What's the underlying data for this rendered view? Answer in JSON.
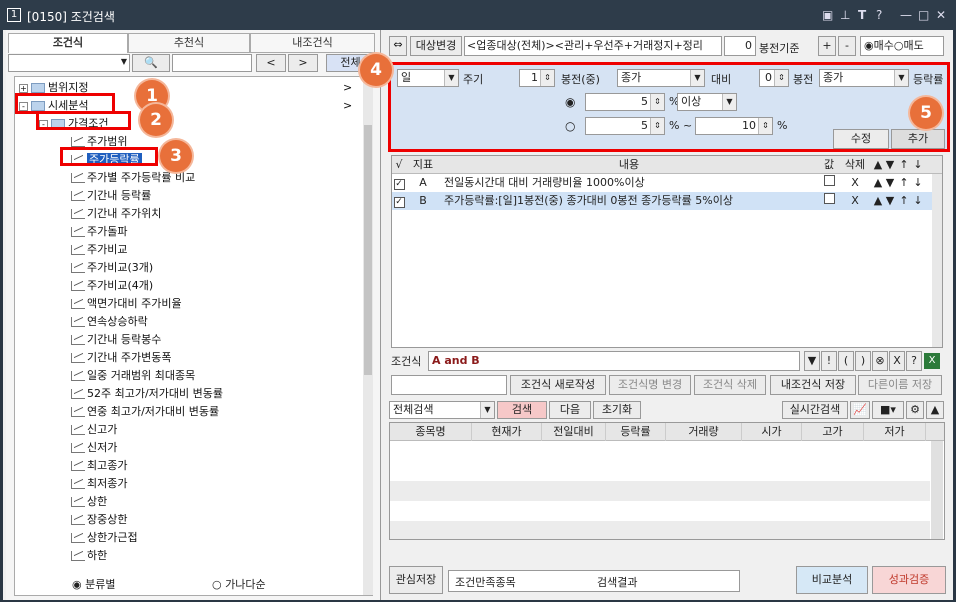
{
  "titlebar": {
    "num": "1",
    "title": "[0150] 조건검색",
    "icons": [
      "window-icon",
      "pin-icon",
      "T",
      "?",
      "minimize-icon",
      "maximize-icon",
      "close-icon"
    ]
  },
  "left": {
    "tabs": [
      "조건식",
      "추천식",
      "내조건식"
    ],
    "nav": {
      "prev": "<",
      "next": ">",
      "all": "전체"
    },
    "tree": [
      {
        "label": "범위지정",
        "level": 0,
        "type": "folder",
        "toggle": "+",
        "arrow": ">"
      },
      {
        "label": "시세분석",
        "level": 0,
        "type": "folder",
        "toggle": "-",
        "arrow": ">"
      },
      {
        "label": "가격조건",
        "level": 1,
        "type": "folder",
        "toggle": "-"
      },
      {
        "label": "주가범위",
        "level": 2,
        "type": "item"
      },
      {
        "label": "주가등락률",
        "level": 2,
        "type": "item",
        "selected": true
      },
      {
        "label": "주가별 주가등락률 비교",
        "level": 2,
        "type": "item"
      },
      {
        "label": "기간내 등락률",
        "level": 2,
        "type": "item"
      },
      {
        "label": "기간내 주가위치",
        "level": 2,
        "type": "item"
      },
      {
        "label": "주가돌파",
        "level": 2,
        "type": "item"
      },
      {
        "label": "주가비교",
        "level": 2,
        "type": "item"
      },
      {
        "label": "주가비교(3개)",
        "level": 2,
        "type": "item"
      },
      {
        "label": "주가비교(4개)",
        "level": 2,
        "type": "item"
      },
      {
        "label": "액면가대비 주가비율",
        "level": 2,
        "type": "item"
      },
      {
        "label": "연속상승하락",
        "level": 2,
        "type": "item"
      },
      {
        "label": "기간내 등락봉수",
        "level": 2,
        "type": "item"
      },
      {
        "label": "기간내 주가변동폭",
        "level": 2,
        "type": "item"
      },
      {
        "label": "일중 거래범위 최대종목",
        "level": 2,
        "type": "item"
      },
      {
        "label": "52주 최고가/저가대비 변동률",
        "level": 2,
        "type": "item"
      },
      {
        "label": "연중 최고가/저가대비 변동률",
        "level": 2,
        "type": "item"
      },
      {
        "label": "신고가",
        "level": 2,
        "type": "item"
      },
      {
        "label": "신저가",
        "level": 2,
        "type": "item"
      },
      {
        "label": "최고종가",
        "level": 2,
        "type": "item"
      },
      {
        "label": "최저종가",
        "level": 2,
        "type": "item"
      },
      {
        "label": "상한",
        "level": 2,
        "type": "item"
      },
      {
        "label": "장중상한",
        "level": 2,
        "type": "item"
      },
      {
        "label": "상한가근접",
        "level": 2,
        "type": "item"
      },
      {
        "label": "하한",
        "level": 2,
        "type": "item"
      }
    ],
    "radio": {
      "opt1": "분류별",
      "opt2": "가나다순"
    }
  },
  "badges": [
    "1",
    "2",
    "3",
    "4",
    "5"
  ],
  "right": {
    "top": {
      "target_btn": "대상변경",
      "target_text": "<업종대상(전체)><관리+우선주+거래정지+정리",
      "bong_value": "0",
      "bong_label": "봉전기준",
      "plus": "+",
      "minus": "-",
      "buy": "매수",
      "sell": "매도"
    },
    "cond": {
      "period": "일",
      "period_label": "주기",
      "n1": "1",
      "bong1": "봉전(중)",
      "price1": "종가",
      "compare": "대비",
      "n2": "0",
      "bong2": "봉전",
      "price2": "종가",
      "rate_label": "등락률",
      "v1": "5",
      "pct": "%",
      "op1": "이상",
      "v2": "5",
      "pct_range": "% ~",
      "v3": "10",
      "pct2": "%",
      "edit": "수정",
      "add": "추가"
    },
    "table": {
      "headers": [
        "√",
        "지표",
        "내용",
        "값",
        "삭제",
        "▲",
        "▼",
        "↑",
        "↓"
      ],
      "rows": [
        {
          "id": "A",
          "content": "전일동시간대 대비 거래량비율 1000%이상",
          "checked": true,
          "del": "X"
        },
        {
          "id": "B",
          "content": "주가등락률:[일]1봉전(중) 종가대비 0봉전 종가등락률 5%이상",
          "checked": true,
          "del": "X"
        }
      ]
    },
    "formula": {
      "label": "조건식",
      "value": "A and B",
      "tools": [
        "▼",
        "!",
        "(",
        ")",
        "⊗",
        "X",
        "?"
      ]
    },
    "actions": [
      "조건식 새로작성",
      "조건식명 변경",
      "조건식 삭제",
      "내조건식 저장",
      "다른이름 저장"
    ],
    "search": {
      "scope": "전체검색",
      "search": "검색",
      "next": "다음",
      "reset": "초기화",
      "realtime": "실시간검색"
    },
    "result_headers": [
      "종목명",
      "현재가",
      "전일대비",
      "등락률",
      "거래량",
      "시가",
      "고가",
      "저가"
    ],
    "bottom": {
      "save": "관심저장",
      "matched": "조건만족종목",
      "result": "검색결과",
      "compare": "비교분석",
      "perf": "성과검증"
    }
  }
}
